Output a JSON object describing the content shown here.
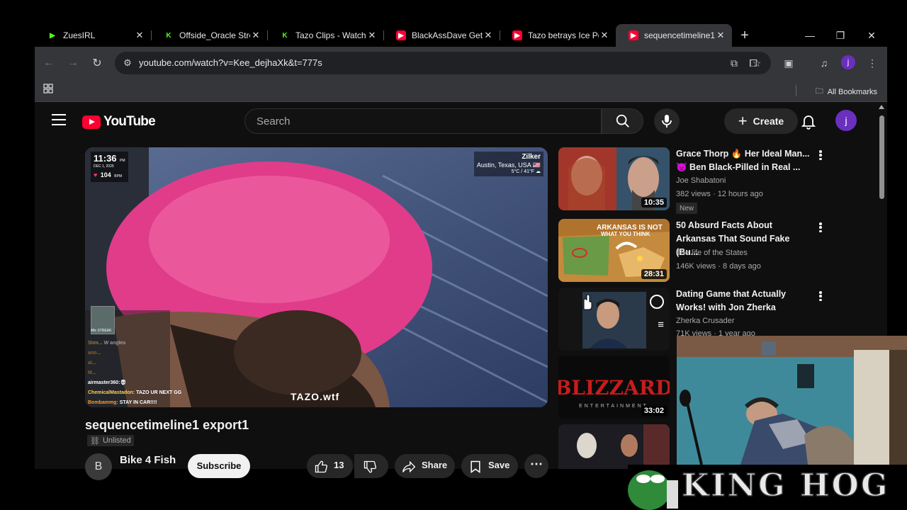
{
  "browser": {
    "tabs": [
      {
        "title": "ZuesIRL",
        "icon": "kick-logo-icon",
        "active": false
      },
      {
        "title": "Offside_Oracle Strea",
        "icon": "kick-logo-icon",
        "active": false
      },
      {
        "title": "Tazo Clips - Watch l",
        "icon": "kick-logo-icon",
        "active": false
      },
      {
        "title": "BlackAssDave Gets",
        "icon": "youtube-logo-icon",
        "active": false
      },
      {
        "title": "Tazo betrays Ice Po",
        "icon": "youtube-logo-icon",
        "active": false
      },
      {
        "title": "sequencetimeline1",
        "icon": "youtube-logo-icon",
        "active": true
      }
    ],
    "url": "youtube.com/watch?v=Kee_dejhaXk&t=777s",
    "profile_initial": "j",
    "bookmarks_label": "All Bookmarks",
    "tab_close_glyph": "✕",
    "new_tab_glyph": "+"
  },
  "youtube": {
    "logo_text": "YouTube",
    "search_placeholder": "Search",
    "create_label": "Create",
    "avatar_initial": "j"
  },
  "video": {
    "title": "sequencetimeline1 export1",
    "visibility": "Unlisted",
    "channel_name": "Bike 4 Fish",
    "channel_initial": "B",
    "subscribe_label": "Subscribe",
    "likes": "13",
    "share_label": "Share",
    "save_label": "Save",
    "overlay": {
      "time": "11:36",
      "ampm": "PM",
      "date": "DEC 1, 2025",
      "heart_rate": "104",
      "bpm_label": "BPM",
      "location_name": "Zilker",
      "location_city": "Austin, Texas, USA 🇺🇸",
      "weather": "5°C / 41°F ☁",
      "streak_label": "48x STREAK",
      "watermark": "TAZO.wtf",
      "chat": [
        {
          "user": "Slim...",
          "text": "W angles"
        },
        {
          "user": "ano...",
          "text": ""
        },
        {
          "user": "al...",
          "text": ""
        },
        {
          "user": "M...",
          "text": ""
        },
        {
          "user": "airmaster360:",
          "text": "💀"
        },
        {
          "user": "ChemicalMastadon:",
          "text": "TAZO UR NEXT GG"
        },
        {
          "user": "Bombammg:",
          "text": "STAY IN CAR!!!!"
        }
      ]
    }
  },
  "recommendations": [
    {
      "title_line1": "Grace Thorp 🔥 Her Ideal Man...",
      "title_line2": "👿 Ben Black-Pilled in Real ...",
      "channel": "Joe Shabatoni",
      "meta": "382 views · 12 hours ago",
      "badge": "New",
      "duration": "10:35"
    },
    {
      "title_line1": "50 Absurd Facts About",
      "title_line2": "Arkansas That Sound Fake (Bu...",
      "channel": "The life of the States",
      "meta": "146K views · 8 days ago",
      "badge": "",
      "duration": "28:31",
      "thumb_text_1": "ARKANSAS IS NOT",
      "thumb_text_2": "WHAT YOU THINK"
    },
    {
      "title_line1": "Dating Game that Actually",
      "title_line2": "Works! with Jon Zherka",
      "channel": "Zherka Crusader",
      "meta": "71K views · 1 year ago",
      "badge": "",
      "duration": ""
    },
    {
      "title_line1": "",
      "title_line2": "",
      "channel": "",
      "meta": "",
      "badge": "",
      "duration": "33:02",
      "thumb_text_1": "BLIZZARD",
      "thumb_text_2": "ENTERTAINMENT"
    }
  ],
  "stream_overlay": {
    "brand": "KING HOG"
  }
}
